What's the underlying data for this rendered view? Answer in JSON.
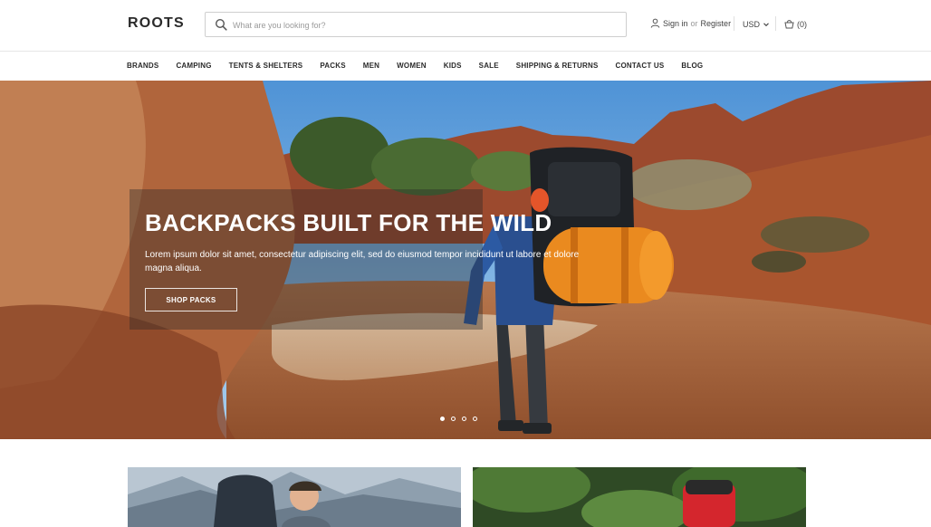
{
  "header": {
    "logo": "ROOTS",
    "search": {
      "placeholder": "What are you looking for?",
      "value": ""
    },
    "account": {
      "sign_in": "Sign in",
      "or": "or",
      "register": "Register"
    },
    "currency": "USD",
    "cart": "(0)"
  },
  "nav": {
    "items": [
      "BRANDS",
      "CAMPING",
      "TENTS & SHELTERS",
      "PACKS",
      "MEN",
      "WOMEN",
      "KIDS",
      "SALE",
      "SHIPPING & RETURNS",
      "CONTACT US",
      "BLOG"
    ]
  },
  "hero": {
    "title": "BACKPACKS BUILT FOR THE WILD",
    "text": "Lorem ipsum dolor sit amet, consectetur adipiscing elit, sed do eiusmod tempor incididunt ut labore et dolore magna aliqua.",
    "button": "SHOP PACKS",
    "slide_count": 4,
    "active_slide": 1
  },
  "icons": {
    "search": "search-icon",
    "user": "user-icon",
    "currency_dropdown": "chevron-down-icon",
    "cart": "shopping-bag-icon"
  },
  "colors": {
    "sky": "#6aa9dd",
    "rock": "#b0653c",
    "pack_orange": "#e8801a"
  }
}
